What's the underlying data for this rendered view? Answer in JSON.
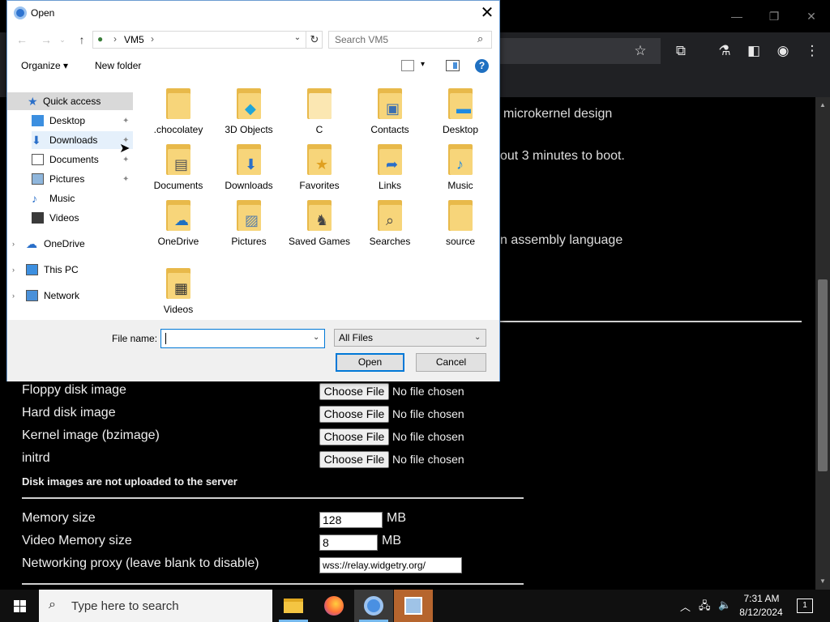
{
  "dialog": {
    "title": "Open",
    "close_glyph": "✕",
    "address": {
      "path": "VM5",
      "sep": "›"
    },
    "search_placeholder": "Search VM5",
    "toolbar": {
      "organize": "Organize ▾",
      "new_folder": "New folder",
      "help": "?"
    },
    "nav": [
      {
        "label": "Quick access",
        "icon": "star-icon"
      },
      {
        "label": "Desktop",
        "icon": "desktop-icon"
      },
      {
        "label": "Downloads",
        "icon": "download-icon"
      },
      {
        "label": "Documents",
        "icon": "document-icon"
      },
      {
        "label": "Pictures",
        "icon": "picture-icon"
      },
      {
        "label": "Music",
        "icon": "music-icon"
      },
      {
        "label": "Videos",
        "icon": "video-icon"
      },
      {
        "label": "OneDrive",
        "icon": "cloud-icon"
      },
      {
        "label": "This PC",
        "icon": "computer-icon"
      },
      {
        "label": "Network",
        "icon": "network-icon"
      }
    ],
    "files": [
      {
        "name": ".chocolatey",
        "deco": ""
      },
      {
        "name": "3D Objects",
        "deco": "◆"
      },
      {
        "name": "C",
        "deco": ""
      },
      {
        "name": "Contacts",
        "deco": "▣"
      },
      {
        "name": "Desktop",
        "deco": "▬"
      },
      {
        "name": "Documents",
        "deco": "▤"
      },
      {
        "name": "Downloads",
        "deco": "⬇"
      },
      {
        "name": "Favorites",
        "deco": "★"
      },
      {
        "name": "Links",
        "deco": "➦"
      },
      {
        "name": "Music",
        "deco": "♪"
      },
      {
        "name": "OneDrive",
        "deco": "☁"
      },
      {
        "name": "Pictures",
        "deco": "▨"
      },
      {
        "name": "Saved Games",
        "deco": "♞"
      },
      {
        "name": "Searches",
        "deco": "⌕"
      },
      {
        "name": "source",
        "deco": ""
      },
      {
        "name": "Videos",
        "deco": "▦"
      }
    ],
    "file_name_label": "File name:",
    "file_name_value": "",
    "file_type": "All Files",
    "open_label": "Open",
    "cancel_label": "Cancel"
  },
  "page": {
    "fragment1": "microkernel design",
    "fragment2": "out 3 minutes to boot.",
    "fragment3": "n assembly language",
    "floppy_label": "Floppy disk image",
    "hdd_label": "Hard disk image",
    "kernel_label": "Kernel image (bzimage)",
    "initrd_label": "initrd",
    "choose_file": "Choose File",
    "no_file": "No file chosen",
    "disk_note": "Disk images are not uploaded to the server",
    "memory_label": "Memory size",
    "memory_value": "128",
    "video_label": "Video Memory size",
    "video_value": "8",
    "unit_mb": "MB",
    "proxy_label": "Networking proxy (leave blank to disable)",
    "proxy_value": "wss://relay.widgetry.org/"
  },
  "taskbar": {
    "search_text": "Type here to search",
    "time": "7:31 AM",
    "date": "8/12/2024",
    "notification_count": "1"
  }
}
